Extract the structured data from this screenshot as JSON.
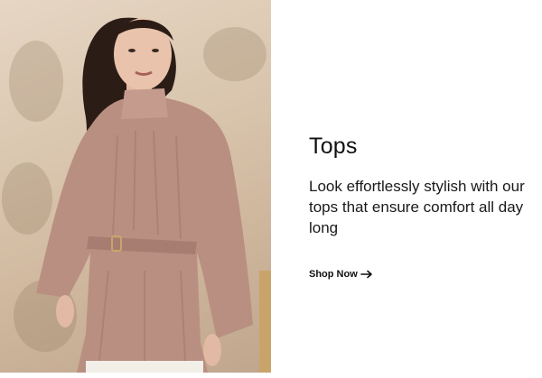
{
  "promo": {
    "title": "Tops",
    "description": "Look effortlessly stylish with our tops that ensure comfort all day long",
    "cta_label": "Shop Now",
    "cta_icon": "arrow-right-icon"
  },
  "image": {
    "subject": "model-in-pink-blouse"
  },
  "colors": {
    "background": "#ffffff",
    "text": "#111111",
    "blouse": "#b98f82",
    "wall": "#d9c5ad"
  }
}
